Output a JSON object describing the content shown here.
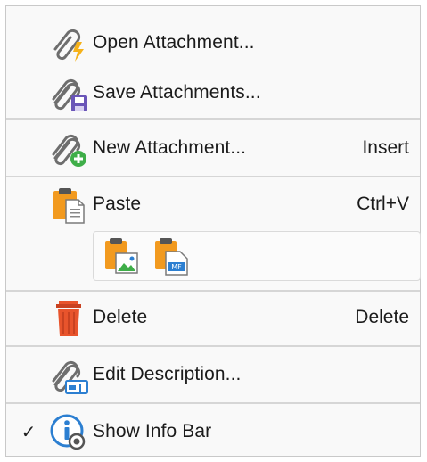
{
  "menu": {
    "items": [
      {
        "label": "Open Attachment...",
        "icon": "open-attachment-icon"
      },
      {
        "label": "Save Attachments...",
        "icon": "save-attachments-icon"
      },
      {
        "label": "New Attachment...",
        "shortcut": "Insert",
        "icon": "new-attachment-icon"
      },
      {
        "label": "Paste",
        "shortcut": "Ctrl+V",
        "icon": "paste-icon"
      },
      {
        "label": "Delete",
        "shortcut": "Delete",
        "icon": "delete-icon"
      },
      {
        "label": "Edit Description...",
        "icon": "edit-description-icon"
      },
      {
        "label": "Show Info Bar",
        "checked": true,
        "check_mark": "✓",
        "icon": "info-bar-icon"
      }
    ],
    "paste_options": [
      {
        "icon": "paste-image-icon"
      },
      {
        "icon": "paste-metafile-icon"
      }
    ]
  },
  "colors": {
    "clip_gray": "#6e6e6e",
    "accent_yellow": "#f6b21a",
    "save_purple": "#6a55b8",
    "add_green": "#3fae49",
    "clipboard_orange": "#f29a1f",
    "delete_red": "#e8542c",
    "info_blue": "#2c7fd1"
  }
}
